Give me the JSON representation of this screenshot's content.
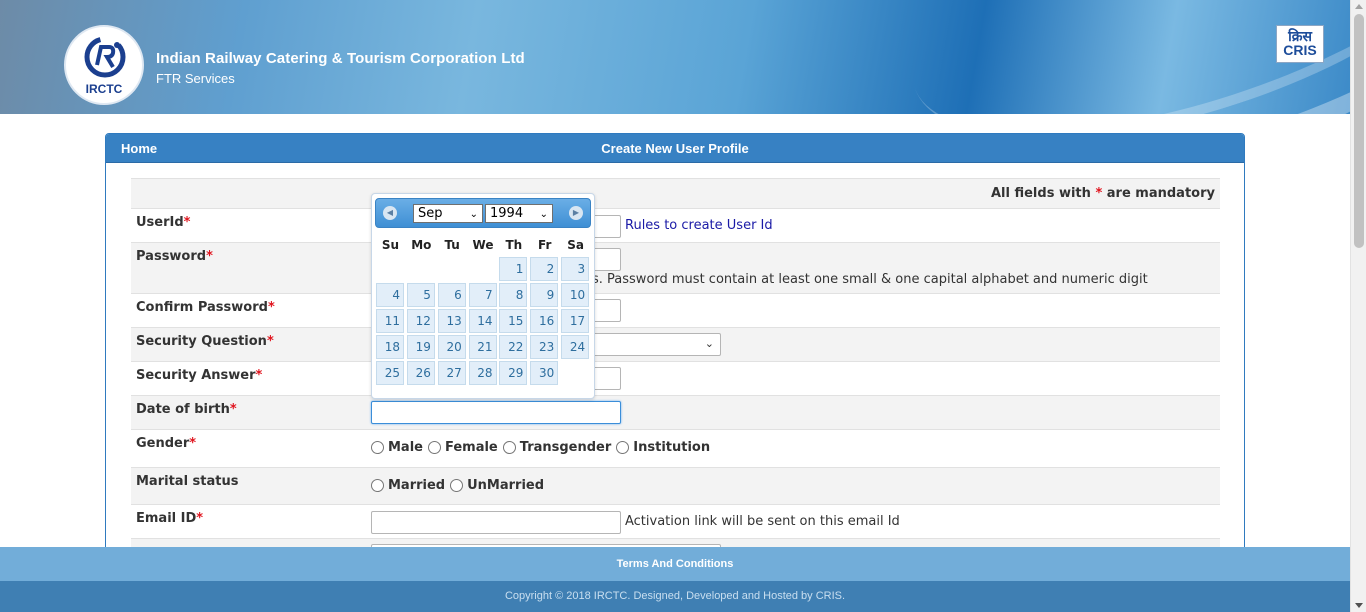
{
  "header": {
    "org_name": "Indian Railway Catering & Tourism Corporation Ltd",
    "org_sub": "FTR Services",
    "logo_text": "IRCTC",
    "cris_hindi": "क्रिस",
    "cris_latin": "CRIS"
  },
  "panel": {
    "home_label": "Home",
    "title": "Create New User Profile",
    "mandatory_text": "All fields with",
    "mandatory_star": "*",
    "mandatory_tail": "are mandatory"
  },
  "form": {
    "userid_label": "UserId",
    "userid_hint": "Rules to create User Id",
    "password_label": "Password",
    "password_hint": "s. Password must contain at least one small & one capital alphabet and numeric digit",
    "confirm_label": "Confirm Password",
    "question_label": "Security Question",
    "answer_label": "Security Answer",
    "dob_label": "Date of birth",
    "gender_label": "Gender",
    "gender_options": [
      "Male",
      "Female",
      "Transgender",
      "Institution"
    ],
    "marital_label": "Marital status",
    "marital_options": [
      "Married",
      "UnMarried"
    ],
    "email_label": "Email ID",
    "email_hint": "Activation link will be sent on this email Id",
    "required_mark": "*"
  },
  "datepicker": {
    "month": "Sep",
    "year": "1994",
    "days_of_week": [
      "Su",
      "Mo",
      "Tu",
      "We",
      "Th",
      "Fr",
      "Sa"
    ],
    "weeks": [
      [
        "",
        "",
        "",
        "",
        "1",
        "2",
        "3"
      ],
      [
        "4",
        "5",
        "6",
        "7",
        "8",
        "9",
        "10"
      ],
      [
        "11",
        "12",
        "13",
        "14",
        "15",
        "16",
        "17"
      ],
      [
        "18",
        "19",
        "20",
        "21",
        "22",
        "23",
        "24"
      ],
      [
        "25",
        "26",
        "27",
        "28",
        "29",
        "30",
        ""
      ]
    ]
  },
  "footer": {
    "terms": "Terms And Conditions",
    "copyright": "Copyright © 2018 IRCTC. Designed, Developed and Hosted by CRIS."
  },
  "colors": {
    "header_blue": "#3781c3",
    "required_red": "#e0141e",
    "link_blue": "#1a1aa6",
    "day_cell": "#e2eef9"
  }
}
